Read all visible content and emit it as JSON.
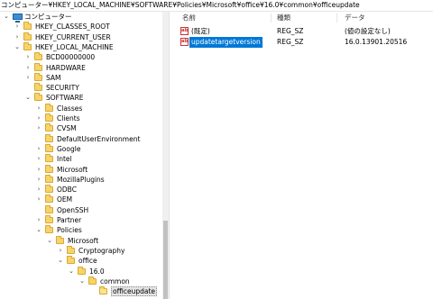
{
  "address_bar": {
    "path": "コンピューター¥HKEY_LOCAL_MACHINE¥SOFTWARE¥Policies¥Microsoft¥office¥16.0¥common¥officeupdate"
  },
  "tree": {
    "items": [
      {
        "label": "コンピューター",
        "level": 0,
        "expander": "collapse",
        "icon": "computer-icon"
      },
      {
        "label": "HKEY_CLASSES_ROOT",
        "level": 1,
        "expander": "expand",
        "icon": "folder-icon"
      },
      {
        "label": "HKEY_CURRENT_USER",
        "level": 1,
        "expander": "expand",
        "icon": "folder-icon"
      },
      {
        "label": "HKEY_LOCAL_MACHINE",
        "level": 1,
        "expander": "collapse",
        "icon": "folder-icon"
      },
      {
        "label": "BCD00000000",
        "level": 2,
        "expander": "expand",
        "icon": "folder-icon"
      },
      {
        "label": "HARDWARE",
        "level": 2,
        "expander": "expand",
        "icon": "folder-icon"
      },
      {
        "label": "SAM",
        "level": 2,
        "expander": "expand",
        "icon": "folder-icon"
      },
      {
        "label": "SECURITY",
        "level": 2,
        "expander": "none",
        "icon": "folder-icon"
      },
      {
        "label": "SOFTWARE",
        "level": 2,
        "expander": "collapse",
        "icon": "folder-icon"
      },
      {
        "label": "Classes",
        "level": 3,
        "expander": "expand",
        "icon": "folder-icon"
      },
      {
        "label": "Clients",
        "level": 3,
        "expander": "expand",
        "icon": "folder-icon"
      },
      {
        "label": "CVSM",
        "level": 3,
        "expander": "expand",
        "icon": "folder-icon"
      },
      {
        "label": "DefaultUserEnvironment",
        "level": 3,
        "expander": "none",
        "icon": "folder-icon"
      },
      {
        "label": "Google",
        "level": 3,
        "expander": "expand",
        "icon": "folder-icon"
      },
      {
        "label": "Intel",
        "level": 3,
        "expander": "expand",
        "icon": "folder-icon"
      },
      {
        "label": "Microsoft",
        "level": 3,
        "expander": "expand",
        "icon": "folder-icon"
      },
      {
        "label": "MozillaPlugins",
        "level": 3,
        "expander": "expand",
        "icon": "folder-icon"
      },
      {
        "label": "ODBC",
        "level": 3,
        "expander": "expand",
        "icon": "folder-icon"
      },
      {
        "label": "OEM",
        "level": 3,
        "expander": "expand",
        "icon": "folder-icon"
      },
      {
        "label": "OpenSSH",
        "level": 3,
        "expander": "none",
        "icon": "folder-icon"
      },
      {
        "label": "Partner",
        "level": 3,
        "expander": "expand",
        "icon": "folder-icon"
      },
      {
        "label": "Policies",
        "level": 3,
        "expander": "collapse",
        "icon": "folder-icon"
      },
      {
        "label": "Microsoft",
        "level": 4,
        "expander": "collapse",
        "icon": "folder-icon"
      },
      {
        "label": "Cryptography",
        "level": 5,
        "expander": "expand",
        "icon": "folder-icon"
      },
      {
        "label": "office",
        "level": 5,
        "expander": "collapse",
        "icon": "folder-icon"
      },
      {
        "label": "16.0",
        "level": 6,
        "expander": "collapse",
        "icon": "folder-icon"
      },
      {
        "label": "common",
        "level": 7,
        "expander": "collapse",
        "icon": "folder-icon"
      },
      {
        "label": "officeupdate",
        "level": 8,
        "expander": "none",
        "icon": "folder-icon",
        "selected": true,
        "open": true
      }
    ]
  },
  "values": {
    "columns": [
      "名前",
      "種類",
      "データ"
    ],
    "rows": [
      {
        "name": "(既定)",
        "type": "REG_SZ",
        "data": "(値の設定なし)",
        "icon": "string-value-icon",
        "selected": false
      },
      {
        "name": "updatetargetversion",
        "type": "REG_SZ",
        "data": "16.0.13901.20516",
        "icon": "string-value-icon",
        "selected": true
      }
    ]
  },
  "icons": {
    "folder": "folder-icon",
    "computer": "computer-icon",
    "value": "string-value-icon"
  },
  "colors": {
    "selection_blue": "#0078d7",
    "folder_yellow": "#f7d469"
  }
}
